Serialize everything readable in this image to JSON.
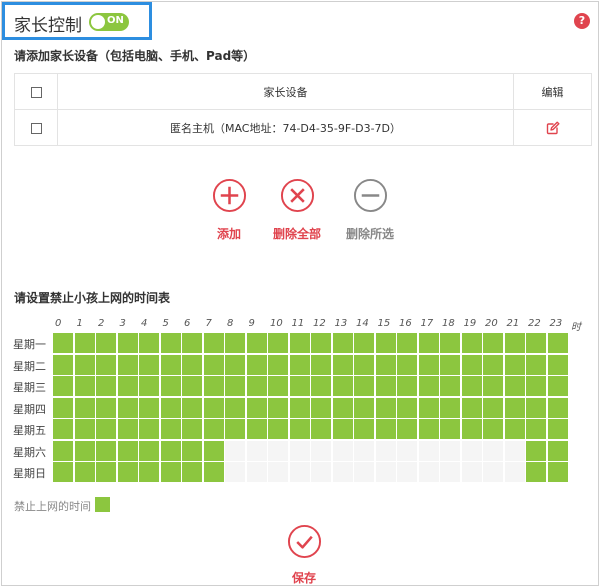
{
  "header": {
    "title": "家长控制",
    "toggle_label": "ON",
    "help_glyph": "?"
  },
  "devices": {
    "section_title": "请添加家长设备（包括电脑、手机、Pad等）",
    "columns": {
      "device": "家长设备",
      "edit": "编辑"
    },
    "rows": [
      {
        "device": "匿名主机（MAC地址：74-D4-35-9F-D3-7D）"
      }
    ]
  },
  "actions": {
    "add": "添加",
    "delete_all": "删除全部",
    "delete_selected": "删除所选"
  },
  "schedule": {
    "section_title": "请设置禁止小孩上网的时间表",
    "hour_labels": [
      "0",
      "1",
      "2",
      "3",
      "4",
      "5",
      "6",
      "7",
      "8",
      "9",
      "10",
      "11",
      "12",
      "13",
      "14",
      "15",
      "16",
      "17",
      "18",
      "19",
      "20",
      "21",
      "22",
      "23",
      "时"
    ],
    "days": [
      "星期一",
      "星期二",
      "星期三",
      "星期四",
      "星期五",
      "星期六",
      "星期日"
    ],
    "grid": [
      [
        1,
        1,
        1,
        1,
        1,
        1,
        1,
        1,
        1,
        1,
        1,
        1,
        1,
        1,
        1,
        1,
        1,
        1,
        1,
        1,
        1,
        1,
        1,
        1
      ],
      [
        1,
        1,
        1,
        1,
        1,
        1,
        1,
        1,
        1,
        1,
        1,
        1,
        1,
        1,
        1,
        1,
        1,
        1,
        1,
        1,
        1,
        1,
        1,
        1
      ],
      [
        1,
        1,
        1,
        1,
        1,
        1,
        1,
        1,
        1,
        1,
        1,
        1,
        1,
        1,
        1,
        1,
        1,
        1,
        1,
        1,
        1,
        1,
        1,
        1
      ],
      [
        1,
        1,
        1,
        1,
        1,
        1,
        1,
        1,
        1,
        1,
        1,
        1,
        1,
        1,
        1,
        1,
        1,
        1,
        1,
        1,
        1,
        1,
        1,
        1
      ],
      [
        1,
        1,
        1,
        1,
        1,
        1,
        1,
        1,
        1,
        1,
        1,
        1,
        1,
        1,
        1,
        1,
        1,
        1,
        1,
        1,
        1,
        1,
        1,
        1
      ],
      [
        1,
        1,
        1,
        1,
        1,
        1,
        1,
        1,
        0,
        0,
        0,
        0,
        0,
        0,
        0,
        0,
        0,
        0,
        0,
        0,
        0,
        0,
        1,
        1
      ],
      [
        1,
        1,
        1,
        1,
        1,
        1,
        1,
        1,
        0,
        0,
        0,
        0,
        0,
        0,
        0,
        0,
        0,
        0,
        0,
        0,
        0,
        0,
        1,
        1
      ]
    ],
    "legend_label": "禁止上网的时间"
  },
  "save": {
    "label": "保存"
  },
  "colors": {
    "accent_red": "#e0444e",
    "grey": "#888888",
    "blocked_green": "#8cc63f",
    "highlight_blue": "#2d8ee0"
  },
  "icons": {
    "help": "question-mark-icon",
    "edit": "edit-pen-icon",
    "add": "plus-circle-icon",
    "delete_all": "x-circle-icon",
    "delete_selected": "minus-circle-icon",
    "save": "check-circle-icon"
  }
}
